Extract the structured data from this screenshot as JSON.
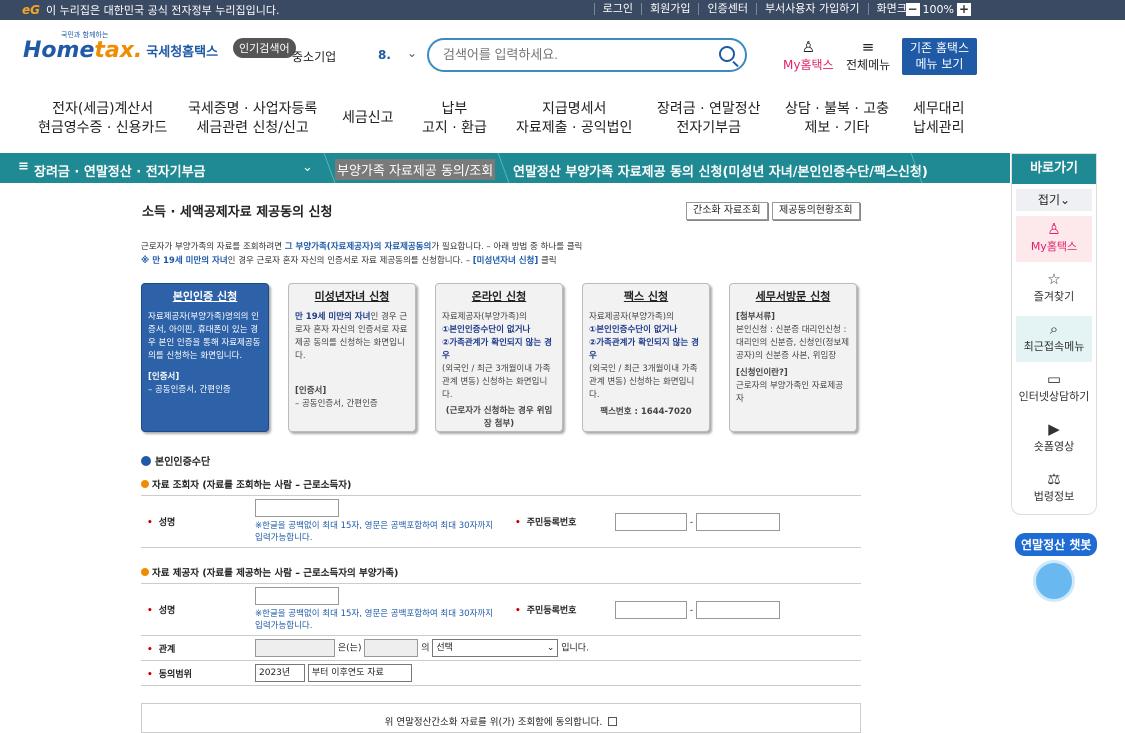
{
  "topbar": {
    "gov_mark": "eG",
    "gov_text": "이 누리집은 대한민국 공식 전자정부 누리집입니다.",
    "links": [
      "로그인",
      "회원가입",
      "인증센터",
      "부서사용자 가입하기",
      "화면크기"
    ],
    "zoom_minus": "−",
    "zoom_value": "100%",
    "zoom_plus": "+"
  },
  "header": {
    "logo_small": "국민과 함께하는",
    "logo_home": "Home",
    "logo_tax": "tax.",
    "logo_name": "국세청홈택스",
    "popular_btn": "인기검색어",
    "popular_word": "중소기업",
    "popular_num": "8. ",
    "search_placeholder": "검색어를 입력하세요.",
    "myhome": "My홈택스",
    "allmenu": "전체메뉴",
    "oldmenu_1": "기존 홈택스",
    "oldmenu_2": "메뉴 보기"
  },
  "gnb": [
    {
      "l1": "전자(세금)계산서",
      "l2": "현금영수증 · 신용카드"
    },
    {
      "l1": "국세증명 · 사업자등록",
      "l2": "세금관련 신청/신고"
    },
    {
      "l1": "세금신고",
      "l2": ""
    },
    {
      "l1": "납부",
      "l2": "고지 · 환급"
    },
    {
      "l1": "지급명세서",
      "l2": "자료제출 · 공익법인"
    },
    {
      "l1": "장려금 · 연말정산",
      "l2": "전자기부금"
    },
    {
      "l1": "상담 · 불복 · 고충",
      "l2": "제보 · 기타"
    },
    {
      "l1": "세무대리",
      "l2": "납세관리"
    }
  ],
  "lnb": {
    "menu": "장려금 · 연말정산 · 전자기부금",
    "menu_icon": "≡",
    "chev": "⌄",
    "second": "부양가족 자료제공 동의/조회",
    "third": "연말정산 부양가족 자료제공 동의 신청(미성년 자녀/본인인증수단/팩스신청)"
  },
  "quick": {
    "title": "바로가기",
    "fold": "접기⌄",
    "items": [
      {
        "label": "My홈택스",
        "icon": "person-icon",
        "glyph": "♙"
      },
      {
        "label": "즐겨찾기",
        "icon": "star-icon",
        "glyph": "☆"
      },
      {
        "label": "최근접속메뉴",
        "icon": "recent-search-icon",
        "glyph": "⌕"
      },
      {
        "label": "인터넷상담하기",
        "icon": "laptop-icon",
        "glyph": "▭"
      },
      {
        "label": "숏폼영상",
        "icon": "play-icon",
        "glyph": "▶"
      },
      {
        "label": "법령정보",
        "icon": "gavel-icon",
        "glyph": "⚖"
      }
    ],
    "chatbot": "연말정산 챗봇"
  },
  "main": {
    "title": "소득 · 세액공제자료 제공동의 신청",
    "btn_simple": "간소화 자료조회",
    "btn_status": "제공동의현황조회",
    "desc1a": "근로자가 부양가족의 자료를 조회하려면 ",
    "desc1b": "그 부양가족(자료제공자)의 자료제공동의",
    "desc1c": "가 필요합니다. – 아래 방법 중 하나를 클릭",
    "desc2a": "※ 만 19세 미만의 자녀",
    "desc2b": "인 경우 근로자 ",
    "desc2c": "혼자 자신의 인증서로 자료 제공동의를 신청합니다. – ",
    "desc2d": "[미성년자녀 신청]",
    "desc2e": " 클릭",
    "cards": [
      {
        "title": "본인인증 신청",
        "body": "자료제공자(부양가족)명의의 인증서, 아이핀, 휴대폰이 있는 경우 본인 인증을 통해 자료제공동의를 신청하는 화면입니다.",
        "extra_t": "[인증서]",
        "extra": "– 공동인증서, 간편인증"
      },
      {
        "title": "미성년자녀 신청",
        "body_b": "만 19세 미만의 자녀",
        "body": "인 경우 근로자 혼자 자신의 인증서로 자료 제공 동의를 신청하는 화면입니다.",
        "extra_t": "[인증서]",
        "extra": "– 공동인증서, 간편인증"
      },
      {
        "title": "온라인 신청",
        "body": "자료제공자(부양가족)의",
        "b1": "①본인인증수단이 없거나",
        "b2": "②가족관계가 확인되지 않는 경우",
        "body2": "(외국인 / 최근 3개월이내 가족관계 변동) 신청하는 화면입니다.",
        "extra": "(근로자가 신청하는 경우 위임장 첨부)"
      },
      {
        "title": "팩스 신청",
        "body": "자료제공자(부양가족)의",
        "b1": "①본인인증수단이 없거나",
        "b2": "②가족관계가 확인되지 않는 경우",
        "body2": "(외국인 / 최근 3개월이내 가족관계 변동) 신청하는 화면입니다.",
        "extra": "팩스번호 : 1644-7020"
      },
      {
        "title": "세무서방문 신청",
        "extra_t": "[첨부서류]",
        "body": "본인신청 : 신분증 대리인신청 : 대리인의 신분증, 신청인(정보제공자)의 신분증 사본, 위임장",
        "b1": "[신청인이란?]",
        "body2": "근로자의 부양가족인 자료제공자"
      }
    ],
    "sec_auth": "본인인증수단",
    "sub_query": "자료 조회자 (자료를 조회하는 사람 – 근로소득자)",
    "sub_provide": "자료 제공자 (자료를 제공하는 사람 – 근로소득자의 부양가족)",
    "lbl_name": "성명",
    "lbl_rrn": "주민등록번호",
    "hint_name": "※한글을 공백없이 최대 15자, 영문은 공백포함하여 최대 30자까지 입력가능합니다.",
    "lbl_relation": "관계",
    "rel_text1": "은(는)",
    "rel_text2": "의",
    "rel_select": "선택",
    "rel_text3": "입니다.",
    "lbl_range": "동의범위",
    "range_year": "2023년",
    "range_option": "부터 이후연도 자료",
    "bottom_text": "위 연말정산간소화 자료를 위(가) 조회함에 동의합니다."
  }
}
